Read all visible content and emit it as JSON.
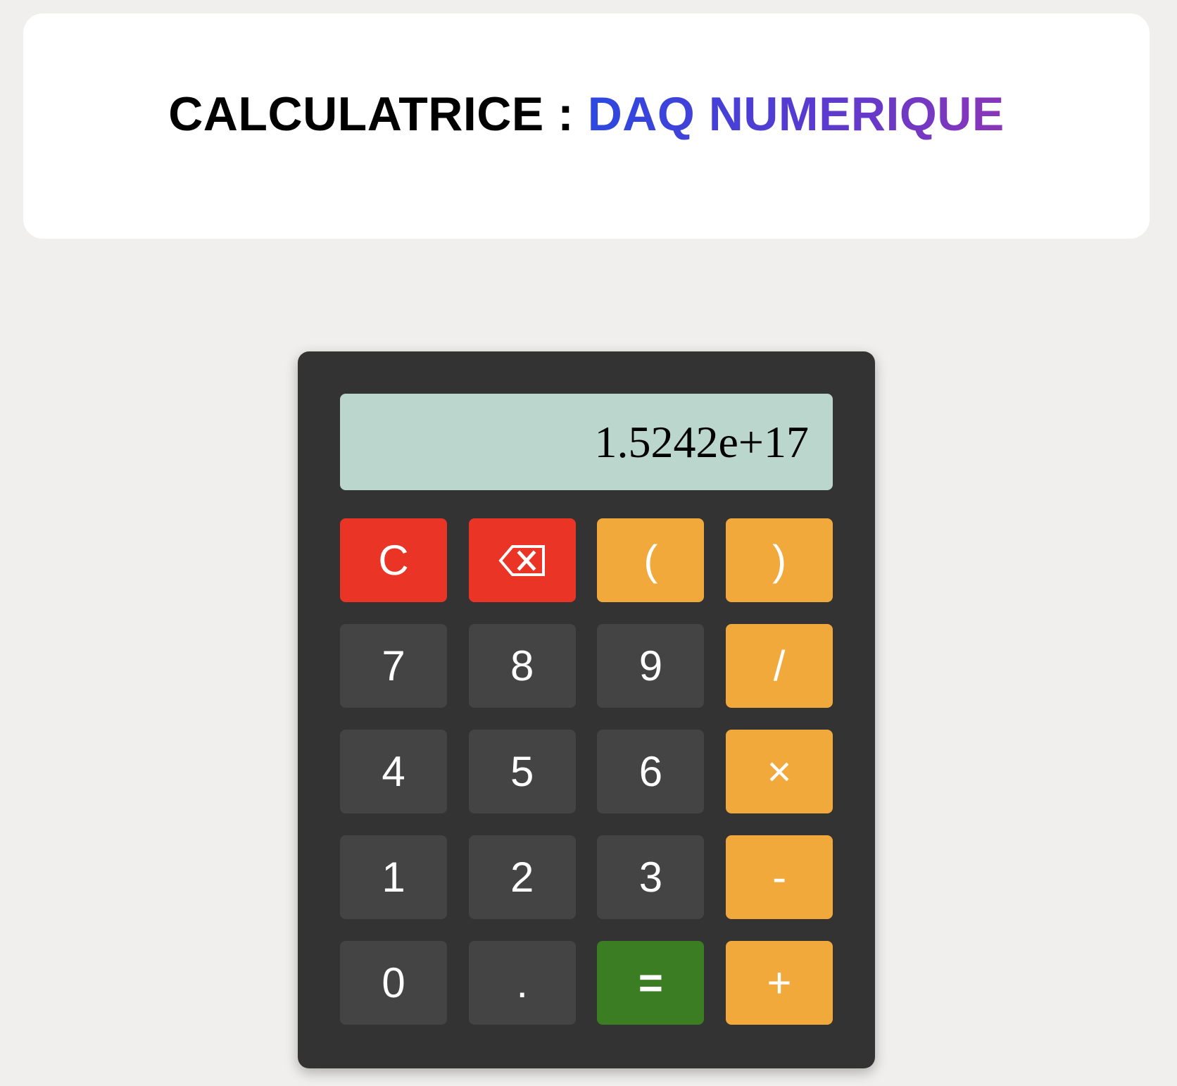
{
  "header": {
    "title_prefix": "CALCULATRICE : ",
    "title_accent": "DAQ NUMERIQUE"
  },
  "calculator": {
    "display_value": "1.5242e+17",
    "keys": [
      {
        "name": "clear-button",
        "label": "C",
        "type": "clear"
      },
      {
        "name": "backspace-button",
        "label": "",
        "type": "clear",
        "icon": "backspace-icon"
      },
      {
        "name": "open-paren-button",
        "label": "(",
        "type": "op"
      },
      {
        "name": "close-paren-button",
        "label": ")",
        "type": "op"
      },
      {
        "name": "digit-7-button",
        "label": "7",
        "type": "num"
      },
      {
        "name": "digit-8-button",
        "label": "8",
        "type": "num"
      },
      {
        "name": "digit-9-button",
        "label": "9",
        "type": "num"
      },
      {
        "name": "divide-button",
        "label": "/",
        "type": "op"
      },
      {
        "name": "digit-4-button",
        "label": "4",
        "type": "num"
      },
      {
        "name": "digit-5-button",
        "label": "5",
        "type": "num"
      },
      {
        "name": "digit-6-button",
        "label": "6",
        "type": "num"
      },
      {
        "name": "multiply-button",
        "label": "×",
        "type": "op"
      },
      {
        "name": "digit-1-button",
        "label": "1",
        "type": "num"
      },
      {
        "name": "digit-2-button",
        "label": "2",
        "type": "num"
      },
      {
        "name": "digit-3-button",
        "label": "3",
        "type": "num"
      },
      {
        "name": "subtract-button",
        "label": "-",
        "type": "op"
      },
      {
        "name": "digit-0-button",
        "label": "0",
        "type": "num"
      },
      {
        "name": "decimal-point-button",
        "label": ".",
        "type": "num"
      },
      {
        "name": "equals-button",
        "label": "=",
        "type": "equals"
      },
      {
        "name": "add-button",
        "label": "+",
        "type": "op"
      }
    ]
  },
  "colors": {
    "page_background": "#f0efed",
    "calculator_body": "#333333",
    "display_background": "#bad6cd",
    "number_key": "#444444",
    "operator_key": "#f2a93b",
    "clear_key": "#e93426",
    "equals_key": "#3a7d23",
    "title_gradient_start": "#2c48e0",
    "title_gradient_end": "#8a36b8"
  }
}
